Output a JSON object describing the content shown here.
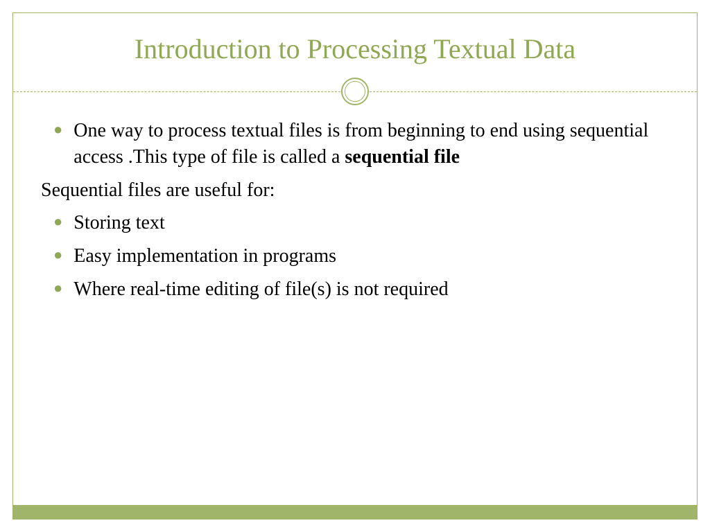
{
  "slide": {
    "title": "Introduction to Processing Textual Data",
    "bullet1_prefix": "One way to process textual files is from beginning to end using sequential access .This type of file is called a ",
    "bullet1_bold": "sequential file",
    "plain1": "Sequential files are useful for:",
    "bullet2": "Storing text",
    "bullet3": "Easy implementation in programs",
    "bullet4": "Where real-time editing of file(s) is not required"
  }
}
